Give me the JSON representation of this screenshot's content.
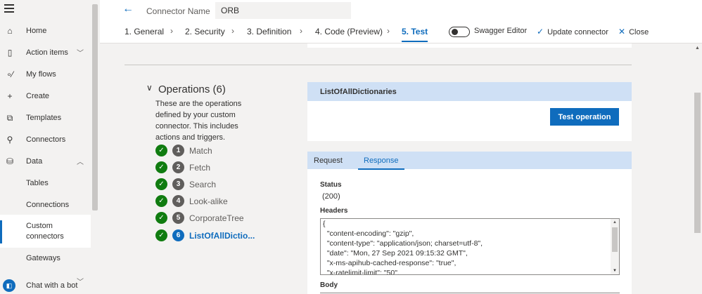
{
  "sidebar": {
    "items": [
      {
        "label": "Home",
        "icon": "home-icon"
      },
      {
        "label": "Action items",
        "icon": "clipboard-icon",
        "chevron": "down"
      },
      {
        "label": "My flows",
        "icon": "flow-icon"
      },
      {
        "label": "Create",
        "icon": "plus-icon"
      },
      {
        "label": "Templates",
        "icon": "templates-icon"
      },
      {
        "label": "Connectors",
        "icon": "connector-icon"
      },
      {
        "label": "Data",
        "icon": "database-icon",
        "chevron": "up"
      },
      {
        "label": "Tables"
      },
      {
        "label": "Connections"
      },
      {
        "label": "Custom connectors",
        "selected": true
      },
      {
        "label": "Gateways"
      },
      {
        "label": "Chat with a bot",
        "icon": "chatbot-icon"
      }
    ]
  },
  "header": {
    "connector_name_label": "Connector Name",
    "connector_name_value": "ORB",
    "steps": [
      {
        "label": "1. General"
      },
      {
        "label": "2. Security"
      },
      {
        "label": "3. Definition"
      },
      {
        "label": "4. Code (Preview)"
      },
      {
        "label": "5. Test",
        "active": true
      }
    ],
    "swagger_label": "Swagger Editor",
    "update_label": "Update connector",
    "close_label": "Close"
  },
  "operations": {
    "title": "Operations (6)",
    "description": "These are the operations defined by your custom connector. This includes actions and triggers.",
    "items": [
      {
        "number": "1",
        "name": "Match"
      },
      {
        "number": "2",
        "name": "Fetch"
      },
      {
        "number": "3",
        "name": "Search"
      },
      {
        "number": "4",
        "name": "Look-alike"
      },
      {
        "number": "5",
        "name": "CorporateTree"
      },
      {
        "number": "6",
        "name": "ListOfAllDictio...",
        "active": true
      }
    ]
  },
  "test_panel": {
    "operation_name": "ListOfAllDictionaries",
    "test_button": "Test operation"
  },
  "response_panel": {
    "tabs": [
      {
        "label": "Request"
      },
      {
        "label": "Response",
        "active": true
      }
    ],
    "status_label": "Status",
    "status_value": "(200)",
    "headers_label": "Headers",
    "headers_lines": [
      "{",
      "  \"content-encoding\": \"gzip\",",
      "  \"content-type\": \"application/json; charset=utf-8\",",
      "  \"date\": \"Mon, 27 Sep 2021 09:15:32 GMT\",",
      "  \"x-ms-apihub-cached-response\": \"true\",",
      "  \"x-ratelimit-limit\": \"50\","
    ],
    "body_label": "Body"
  },
  "colors": {
    "accent": "#0f6cbd",
    "success": "#107c10",
    "panel_header": "#cfe0f5"
  }
}
